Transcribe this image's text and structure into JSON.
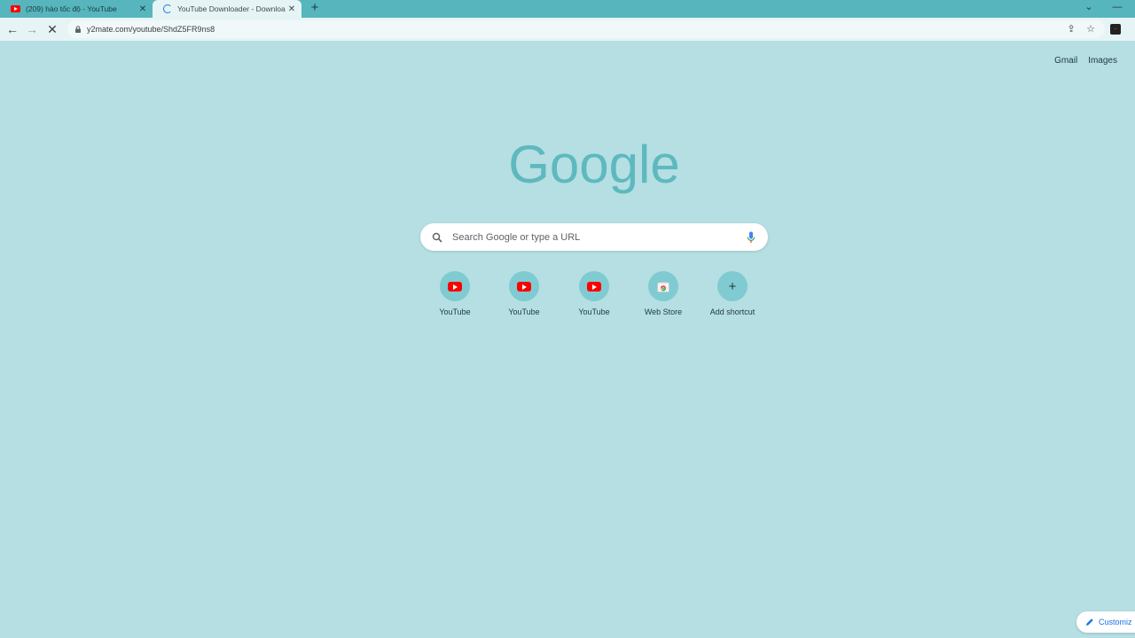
{
  "tabs": [
    {
      "title": "(209) hào tốc độ - YouTube",
      "favicon": "youtube-icon"
    },
    {
      "title": "YouTube Downloader - Downloa",
      "favicon": "loading-spinner-icon"
    }
  ],
  "toolbar": {
    "url": "y2mate.com/youtube/ShdZ5FR9ns8"
  },
  "top_links": {
    "gmail": "Gmail",
    "images": "Images"
  },
  "logo": {
    "text": "Google",
    "color": "#5eb9bf"
  },
  "search": {
    "placeholder": "Search Google or type a URL"
  },
  "shortcuts": [
    {
      "label": "YouTube",
      "icon": "youtube-icon"
    },
    {
      "label": "YouTube",
      "icon": "youtube-icon"
    },
    {
      "label": "YouTube",
      "icon": "youtube-icon"
    },
    {
      "label": "Web Store",
      "icon": "web-store-icon"
    },
    {
      "label": "Add shortcut",
      "icon": "plus-icon"
    }
  ],
  "customize": {
    "label": "Customiz"
  },
  "colors": {
    "background": "#b5dfe3",
    "tabstrip": "#56b5bd",
    "toolbar": "#e6f4f5",
    "shortcut_circle": "#7fcbd1"
  }
}
